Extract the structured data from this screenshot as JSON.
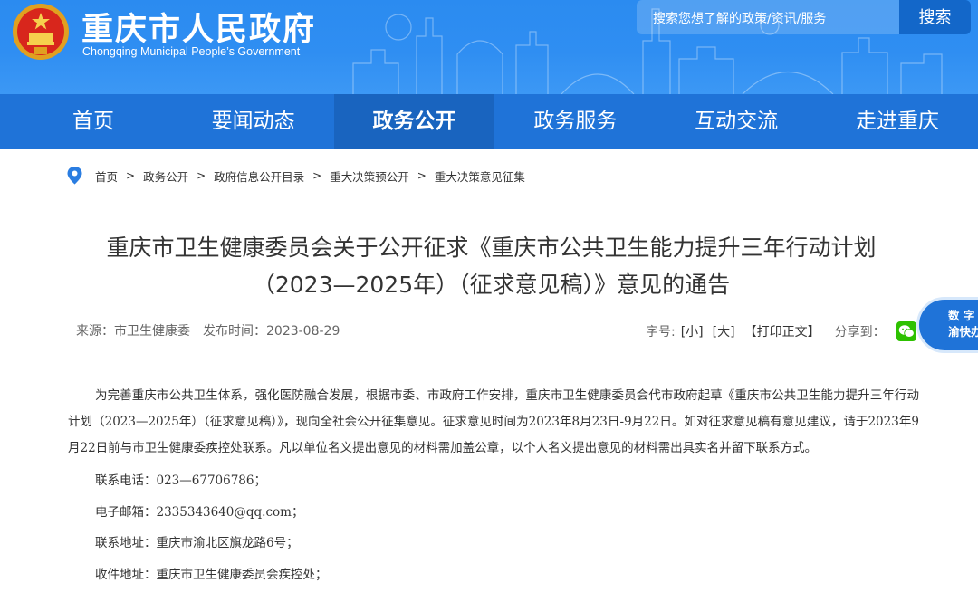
{
  "header": {
    "site_title": "重庆市人民政府",
    "site_subtitle": "Chongqing Municipal People’s Government",
    "search_placeholder": "搜索您想了解的政策/资讯/服务",
    "search_button": "搜索"
  },
  "nav": {
    "items": [
      {
        "label": "首页",
        "active": false
      },
      {
        "label": "要闻动态",
        "active": false
      },
      {
        "label": "政务公开",
        "active": true
      },
      {
        "label": "政务服务",
        "active": false
      },
      {
        "label": "互动交流",
        "active": false
      },
      {
        "label": "走进重庆",
        "active": false
      }
    ]
  },
  "breadcrumb": {
    "items": [
      "首页",
      "政务公开",
      "政府信息公开目录",
      "重大决策预公开",
      "重大决策意见征集"
    ],
    "separator": ">"
  },
  "article": {
    "title_line1": "重庆市卫生健康委员会关于公开征求《重庆市公共卫生能力提升三年行动计划",
    "title_line2": "（2023—2025年）（征求意见稿）》意见的通告",
    "source": "来源：市卫生健康委",
    "publish_time": "发布时间：2023-08-29",
    "font_size_label": "字号:",
    "font_small": "[小]",
    "font_large": "[大]",
    "print": "【打印正文】",
    "share_label": "分享到：",
    "paragraph": "为完善重庆市公共卫生体系，强化医防融合发展，根据市委、市政府工作安排，重庆市卫生健康委员会代市政府起草《重庆市公共卫生能力提升三年行动计划（2023—2025年）（征求意见稿）》，现向全社会公开征集意见。征求意见时间为2023年8月23日-9月22日。如对征求意见稿有意见建议，请于2023年9月22日前与市卫生健康委疾控处联系。凡以单位名义提出意见的材料需加盖公章，以个人名义提出意见的材料需出具实名并留下联系方式。",
    "contact_phone": "联系电话：023—67706786；",
    "contact_email": "电子邮箱：2335343640@qq.com；",
    "contact_address": "联系地址：重庆市渝北区旗龙路6号；",
    "receiver_address": "收件地址：重庆市卫生健康委员会疾控处；"
  },
  "float_panel": {
    "line1": "数 字",
    "line2": "渝快办"
  },
  "colors": {
    "header_blue": "#2f8ef2",
    "nav_blue": "#1f73d8",
    "nav_active": "#1964bf",
    "search_button": "#1367c9",
    "wechat_green": "#2dc100"
  },
  "icons": {
    "emblem": "national-emblem-icon",
    "location": "location-pin-icon",
    "wechat": "wechat-icon"
  }
}
